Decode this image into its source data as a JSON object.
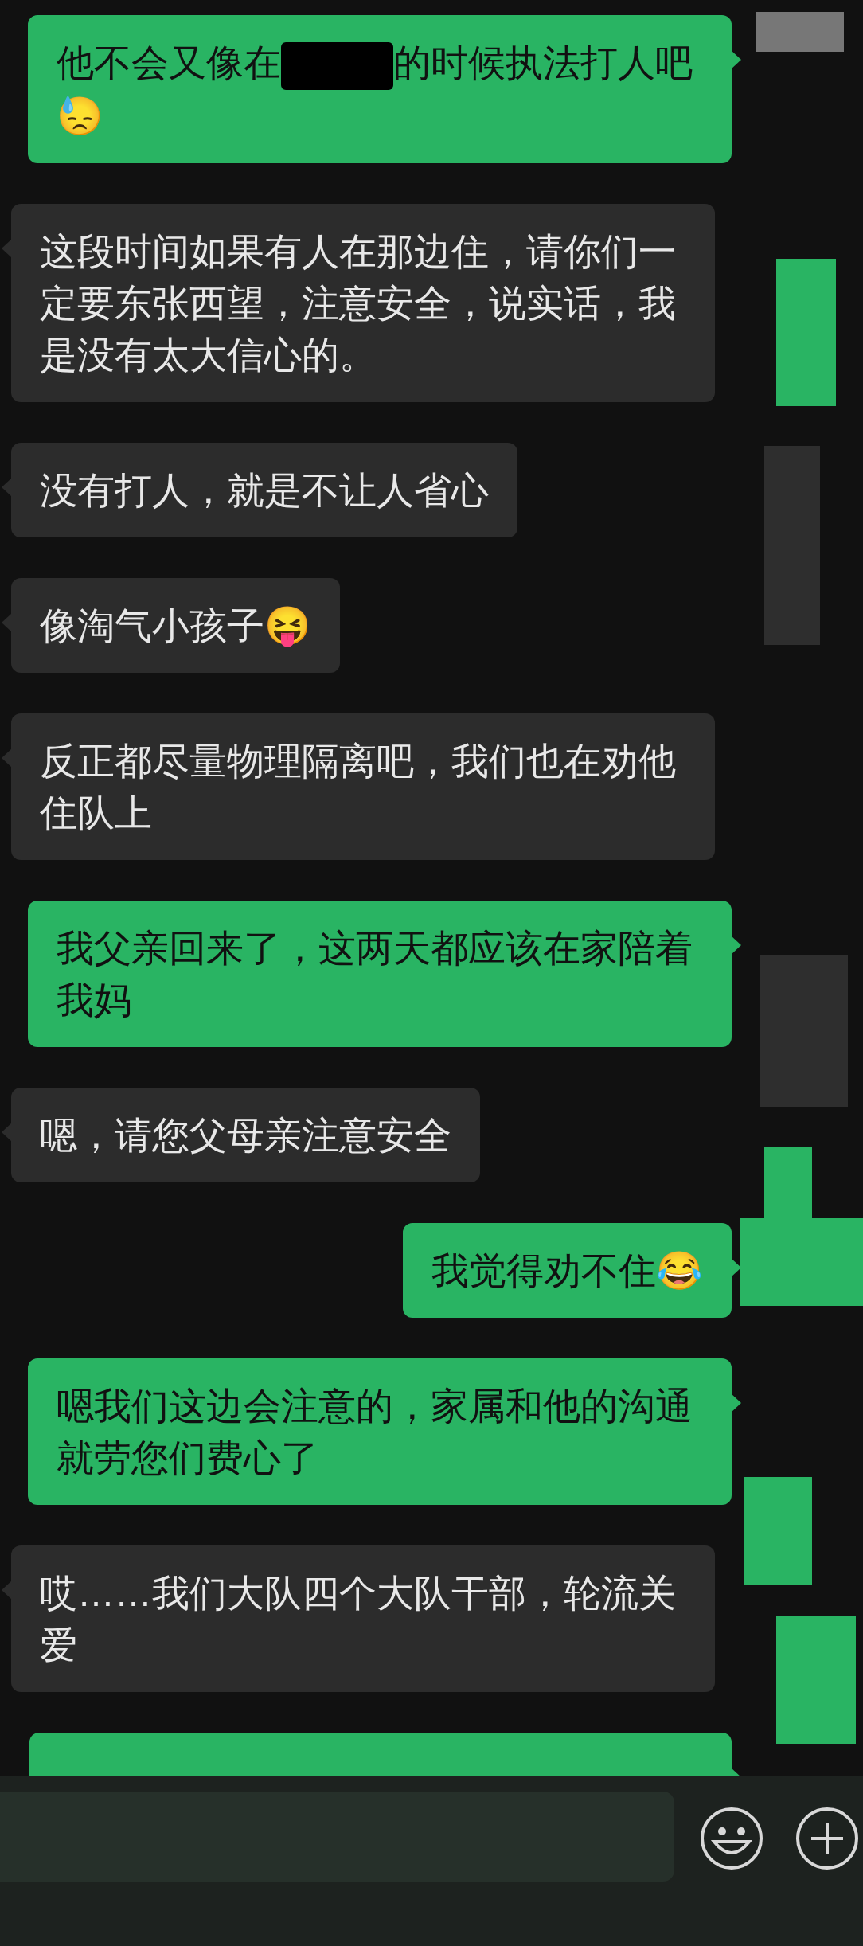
{
  "messages": [
    {
      "kind": "sent",
      "parts": [
        {
          "kind": "text",
          "text": "他不会又像在"
        },
        {
          "kind": "redaction"
        },
        {
          "kind": "text",
          "text": "的时候执法打人吧"
        },
        {
          "kind": "text",
          "text": "😓"
        }
      ]
    },
    {
      "kind": "received",
      "parts": [
        {
          "kind": "text",
          "text": "这段时间如果有人在那边住，请你们一定要东张西望，注意安全，说实话，我是没有太大信心的。"
        }
      ]
    },
    {
      "kind": "received",
      "parts": [
        {
          "kind": "text",
          "text": "没有打人，就是不让人省心"
        }
      ]
    },
    {
      "kind": "received",
      "parts": [
        {
          "kind": "text",
          "text": "像淘气小孩子😝"
        }
      ]
    },
    {
      "kind": "received",
      "parts": [
        {
          "kind": "text",
          "text": "反正都尽量物理隔离吧，我们也在劝他住队上"
        }
      ]
    },
    {
      "kind": "sent",
      "parts": [
        {
          "kind": "text",
          "text": "我父亲回来了，这两天都应该在家陪着我妈"
        }
      ]
    },
    {
      "kind": "received",
      "parts": [
        {
          "kind": "text",
          "text": "嗯，请您父母亲注意安全"
        }
      ]
    },
    {
      "kind": "sent",
      "parts": [
        {
          "kind": "text",
          "text": "我觉得劝不住😂"
        }
      ]
    },
    {
      "kind": "sent",
      "parts": [
        {
          "kind": "text",
          "text": "嗯我们这边会注意的，家属和他的沟通就劳您们费心了"
        }
      ]
    },
    {
      "kind": "received",
      "parts": [
        {
          "kind": "text",
          "text": "哎……我们大队四个大队干部，轮流关爱"
        }
      ]
    },
    {
      "kind": "sent"
    }
  ]
}
